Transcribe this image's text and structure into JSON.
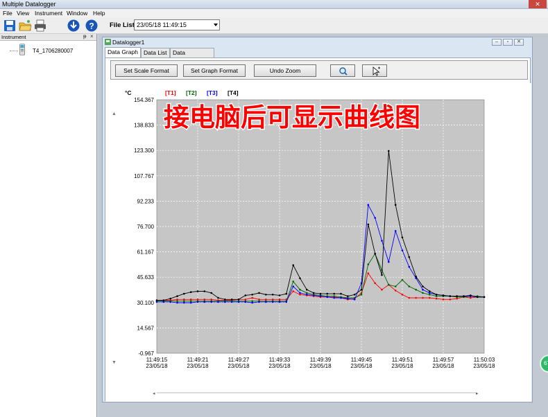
{
  "app": {
    "title": "Multiple Datalogger",
    "menu": [
      "File",
      "View",
      "Instrument",
      "Window",
      "Help"
    ]
  },
  "toolbar": {
    "icons": [
      "save-icon",
      "open-folder-icon",
      "print-icon",
      "download-icon",
      "help-icon"
    ],
    "file_list_label": "File List",
    "file_list_value": "23/05/18 11:49:15"
  },
  "instrument_panel": {
    "title": "Instrument",
    "pin_glyph": "ᵽ",
    "close_glyph": "×",
    "items": [
      "T4_1706280007"
    ]
  },
  "child_window": {
    "title": "Datalogger1",
    "tabs": [
      "Data Graph",
      "Data List",
      "Data Summary"
    ],
    "active_tab": 0,
    "buttons": {
      "set_scale": "Set Scale Format",
      "set_graph": "Set Graph Format",
      "undo_zoom": "Undo Zoom"
    }
  },
  "overlay_text": "接电脑后可显示曲线图",
  "side_badge": "67",
  "colors": {
    "T1": "#ff0000",
    "T2": "#006600",
    "T3": "#0000ff",
    "T4": "#000000",
    "plot_bg": "#c6c6c6",
    "overlay": "#ff0000"
  },
  "chart_data": {
    "type": "line",
    "ylabel": "°C",
    "ylim": [
      -0.967,
      154.367
    ],
    "yticks": [
      "154.367",
      "138.833",
      "123.300",
      "107.767",
      "92.233",
      "76.700",
      "61.167",
      "45.633",
      "30.100",
      "14.567",
      "-0.967"
    ],
    "xticks": [
      {
        "time": "11:49:15",
        "date": "23/05/18"
      },
      {
        "time": "11:49:21",
        "date": "23/05/18"
      },
      {
        "time": "11:49:27",
        "date": "23/05/18"
      },
      {
        "time": "11:49:33",
        "date": "23/05/18"
      },
      {
        "time": "11:49:39",
        "date": "23/05/18"
      },
      {
        "time": "11:49:45",
        "date": "23/05/18"
      },
      {
        "time": "11:49:51",
        "date": "23/05/18"
      },
      {
        "time": "11:49:57",
        "date": "23/05/18"
      },
      {
        "time": "11:50:03",
        "date": "23/05/18"
      }
    ],
    "x_seconds": [
      0,
      1,
      2,
      3,
      4,
      5,
      6,
      7,
      8,
      9,
      10,
      11,
      12,
      13,
      14,
      15,
      16,
      17,
      18,
      19,
      20,
      21,
      22,
      23,
      24,
      25,
      26,
      27,
      28,
      29,
      30,
      31,
      32,
      33,
      34,
      35,
      36,
      37,
      38,
      39,
      40,
      41,
      42,
      43,
      44,
      45,
      46,
      47,
      48
    ],
    "grid": true,
    "legend": "top-left",
    "series": [
      {
        "name": "T1",
        "values": [
          31.5,
          31.5,
          31.5,
          32.0,
          32.0,
          32.0,
          32.0,
          32.0,
          32.0,
          31.5,
          31.5,
          31.5,
          32.0,
          32.0,
          33.0,
          32.0,
          32.0,
          32.0,
          32.0,
          32.0,
          37.0,
          35.0,
          34.5,
          34.0,
          33.5,
          33.5,
          33.5,
          33.0,
          32.0,
          32.5,
          36.0,
          48.0,
          42.0,
          38.0,
          41.0,
          37.5,
          35.0,
          33.0,
          33.0,
          33.0,
          33.0,
          32.5,
          32.0,
          32.0,
          32.5,
          33.5,
          33.0,
          33.5,
          33.5
        ]
      },
      {
        "name": "T2",
        "values": [
          31.0,
          31.0,
          31.0,
          31.0,
          31.0,
          31.0,
          31.0,
          31.0,
          31.0,
          31.0,
          31.0,
          31.0,
          31.0,
          31.0,
          31.0,
          31.0,
          31.0,
          31.0,
          31.0,
          31.0,
          43.0,
          38.0,
          36.0,
          35.0,
          34.5,
          34.0,
          34.0,
          33.5,
          33.0,
          33.0,
          35.0,
          53.5,
          60.0,
          50.0,
          41.0,
          40.0,
          44.0,
          40.0,
          38.0,
          36.0,
          35.0,
          34.0,
          34.0,
          34.0,
          33.5,
          33.5,
          34.0,
          34.0,
          33.5
        ]
      },
      {
        "name": "T3",
        "values": [
          30.5,
          30.5,
          30.5,
          30.0,
          30.0,
          30.0,
          30.5,
          30.5,
          30.5,
          30.5,
          30.5,
          30.5,
          30.5,
          30.5,
          30.0,
          30.5,
          30.5,
          30.5,
          30.5,
          30.5,
          40.0,
          36.0,
          35.0,
          34.5,
          34.0,
          33.5,
          33.0,
          33.0,
          32.5,
          32.0,
          42.0,
          90.0,
          82.0,
          68.0,
          55.0,
          74.0,
          62.0,
          52.0,
          45.0,
          38.0,
          36.0,
          35.0,
          34.5,
          34.0,
          34.0,
          34.0,
          34.0,
          33.5,
          33.5
        ]
      },
      {
        "name": "T4",
        "values": [
          31.5,
          31.5,
          32.5,
          34.0,
          35.5,
          36.5,
          37.0,
          37.0,
          36.0,
          33.0,
          32.0,
          32.0,
          32.0,
          34.5,
          35.0,
          36.0,
          35.0,
          35.0,
          34.5,
          35.5,
          53.0,
          45.0,
          38.0,
          36.0,
          35.5,
          35.5,
          35.5,
          35.5,
          34.0,
          35.0,
          38.0,
          78.0,
          60.0,
          47.0,
          123.0,
          90.0,
          70.0,
          58.0,
          46.0,
          40.0,
          37.0,
          35.0,
          34.5,
          34.0,
          34.0,
          34.0,
          34.5,
          33.5,
          33.5
        ]
      }
    ]
  }
}
